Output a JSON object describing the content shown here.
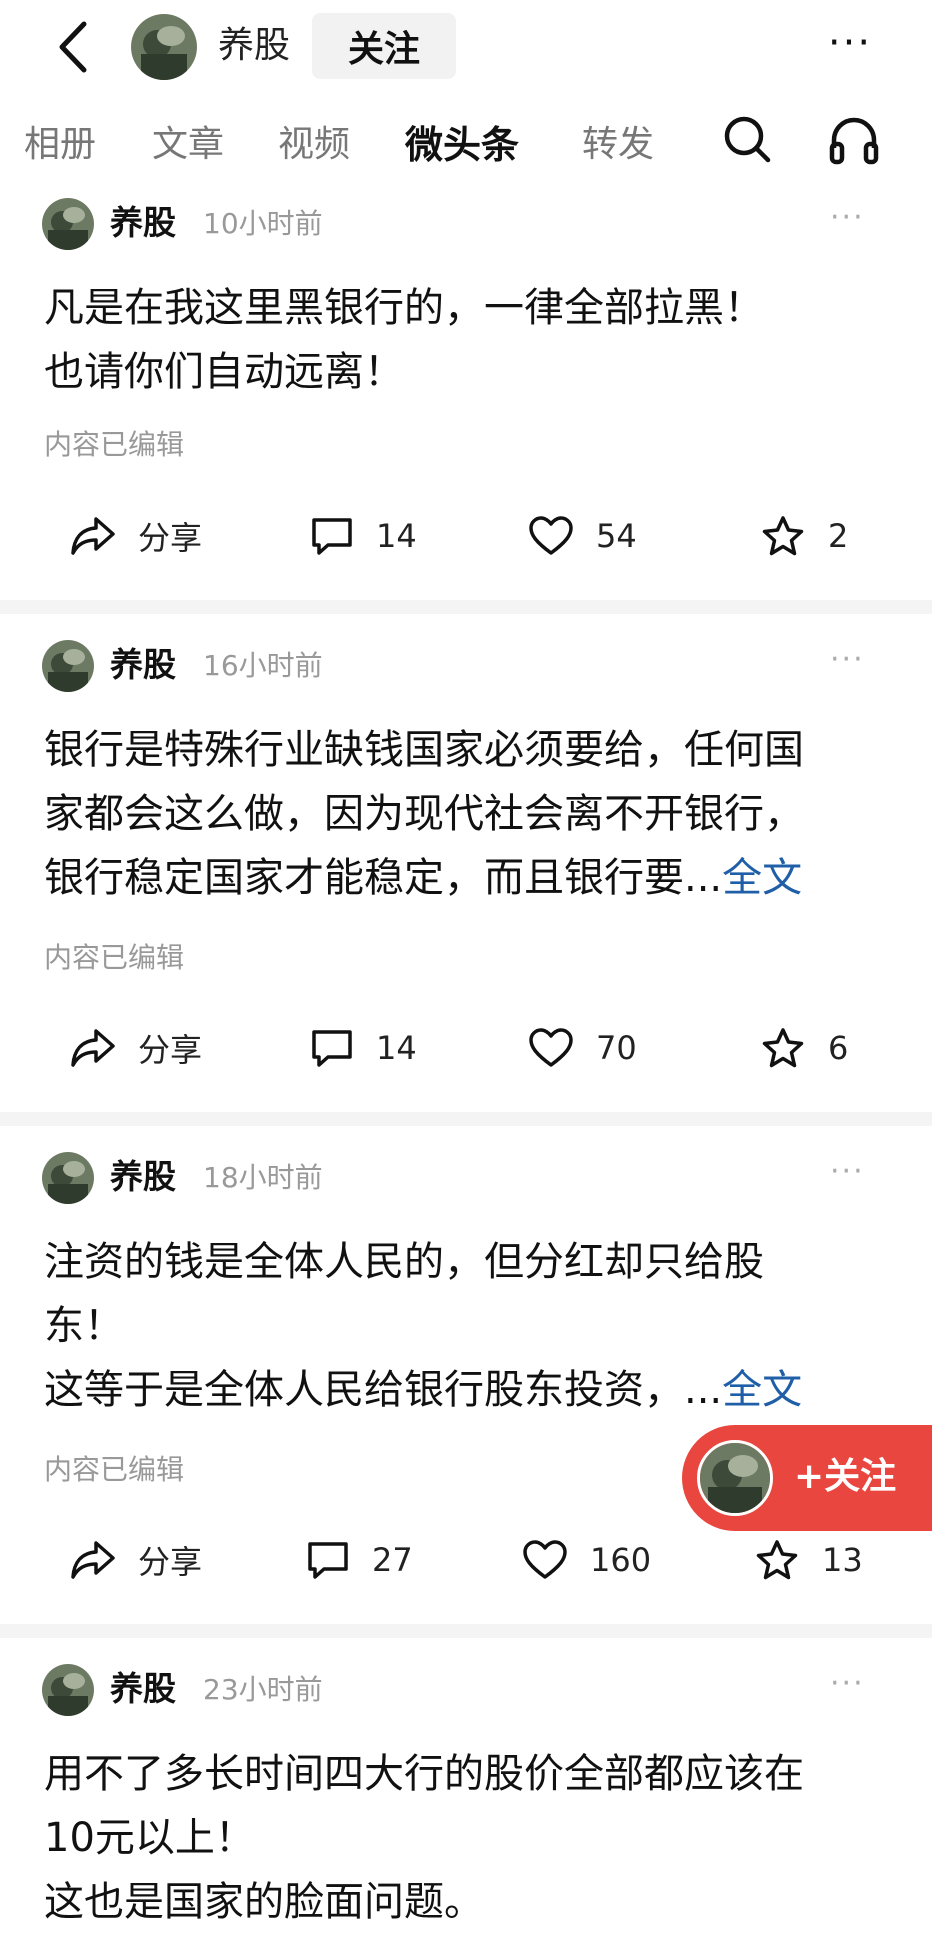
{
  "header": {
    "username": "养股",
    "follow_label": "关注",
    "more_label": "···"
  },
  "tabs": [
    {
      "label": "相册"
    },
    {
      "label": "文章"
    },
    {
      "label": "视频"
    },
    {
      "label": "微头条",
      "active": true
    },
    {
      "label": "转发"
    }
  ],
  "posts": [
    {
      "author": "养股",
      "time": "10小时前",
      "lines": [
        "凡是在我这里黑银行的，一律全部拉黑！",
        "也请你们自动远离！"
      ],
      "edited": "内容已编辑",
      "share_label": "分享",
      "comments": "14",
      "likes": "54",
      "favorites": "2"
    },
    {
      "author": "养股",
      "time": "16小时前",
      "lines": [
        "银行是特殊行业缺钱国家必须要给，任何国",
        "家都会这么做，因为现代社会离不开银行，",
        "银行稳定国家才能稳定，而且银行要..."
      ],
      "full_label": "全文",
      "edited": "内容已编辑",
      "share_label": "分享",
      "comments": "14",
      "likes": "70",
      "favorites": "6"
    },
    {
      "author": "养股",
      "time": "18小时前",
      "lines": [
        "注资的钱是全体人民的，但分红却只给股",
        "东！",
        "这等于是全体人民给银行股东投资，..."
      ],
      "full_label": "全文",
      "edited": "内容已编辑",
      "share_label": "分享",
      "comments": "27",
      "likes": "160",
      "favorites": "13"
    },
    {
      "author": "养股",
      "time": "23小时前",
      "lines": [
        "用不了多长时间四大行的股价全部都应该在",
        "10元以上！",
        "这也是国家的脸面问题。"
      ]
    }
  ],
  "float_follow": {
    "label": "+关注"
  },
  "colors": {
    "accent_red": "#e9463f",
    "link_blue": "#1f5fa8"
  }
}
